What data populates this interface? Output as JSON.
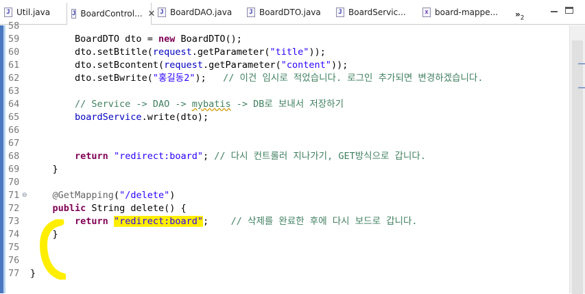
{
  "tabs": [
    {
      "label": "Util.java",
      "icon": "java-file-icon",
      "active": false
    },
    {
      "label": "BoardControl...",
      "icon": "java-file-icon",
      "active": true
    },
    {
      "label": "BoardDAO.java",
      "icon": "java-file-icon",
      "active": false
    },
    {
      "label": "BoardDTO.java",
      "icon": "java-file-icon",
      "active": false
    },
    {
      "label": "BoardServic...",
      "icon": "java-file-icon",
      "active": false
    },
    {
      "label": "board-mappe...",
      "icon": "xml-file-icon",
      "active": false
    }
  ],
  "tab_overflow": {
    "label": "»",
    "count": "2"
  },
  "editor": {
    "lines": [
      {
        "num": "58",
        "tokens": []
      },
      {
        "num": "59",
        "tokens": [
          {
            "t": "BoardDTO dto = ",
            "c": ""
          },
          {
            "t": "new",
            "c": "kw"
          },
          {
            "t": " BoardDTO();",
            "c": ""
          }
        ],
        "indent": "        "
      },
      {
        "num": "60",
        "tokens": [
          {
            "t": "dto.setBtitle(",
            "c": ""
          },
          {
            "t": "request",
            "c": "fld"
          },
          {
            "t": ".getParameter(",
            "c": ""
          },
          {
            "t": "\"title\"",
            "c": "str"
          },
          {
            "t": "));",
            "c": ""
          }
        ],
        "indent": "        "
      },
      {
        "num": "61",
        "tokens": [
          {
            "t": "dto.setBcontent(",
            "c": ""
          },
          {
            "t": "request",
            "c": "fld"
          },
          {
            "t": ".getParameter(",
            "c": ""
          },
          {
            "t": "\"content\"",
            "c": "str"
          },
          {
            "t": "));",
            "c": ""
          }
        ],
        "indent": "        "
      },
      {
        "num": "62",
        "tokens": [
          {
            "t": "dto.setBwrite(",
            "c": ""
          },
          {
            "t": "\"홍길동2\"",
            "c": "str"
          },
          {
            "t": ");   ",
            "c": ""
          },
          {
            "t": "// 이건 임시로 적었습니다. 로그인 추가되면 변경하겠습니다.",
            "c": "cm"
          }
        ],
        "indent": "        "
      },
      {
        "num": "63",
        "tokens": []
      },
      {
        "num": "64",
        "tokens": [
          {
            "t": "// Service -> DAO -> ",
            "c": "cm"
          },
          {
            "t": "mybatis",
            "c": "cm squig"
          },
          {
            "t": " -> DB로 보내서 저장하기",
            "c": "cm"
          }
        ],
        "indent": "        "
      },
      {
        "num": "65",
        "tokens": [
          {
            "t": "boardService",
            "c": "fld"
          },
          {
            "t": ".write(dto);",
            "c": ""
          }
        ],
        "indent": "        "
      },
      {
        "num": "66",
        "tokens": []
      },
      {
        "num": "67",
        "tokens": []
      },
      {
        "num": "68",
        "tokens": [
          {
            "t": "return",
            "c": "kw"
          },
          {
            "t": " ",
            "c": ""
          },
          {
            "t": "\"redirect:board\"",
            "c": "str"
          },
          {
            "t": "; ",
            "c": ""
          },
          {
            "t": "// 다시 컨트롤러 지나가기, GET방식으로 갑니다.",
            "c": "cm"
          }
        ],
        "indent": "        "
      },
      {
        "num": "69",
        "tokens": [
          {
            "t": "}",
            "c": ""
          }
        ],
        "indent": "    "
      },
      {
        "num": "70",
        "tokens": []
      },
      {
        "num": "71",
        "tokens": [
          {
            "t": "@GetMapping",
            "c": "ann"
          },
          {
            "t": "(",
            "c": ""
          },
          {
            "t": "\"/delete\"",
            "c": "str"
          },
          {
            "t": ")",
            "c": ""
          }
        ],
        "indent": "    ",
        "fold": "⊖"
      },
      {
        "num": "72",
        "tokens": [
          {
            "t": "public",
            "c": "kw"
          },
          {
            "t": " String delete() {",
            "c": ""
          }
        ],
        "indent": "    "
      },
      {
        "num": "73",
        "tokens": [
          {
            "t": "return",
            "c": "kw"
          },
          {
            "t": " ",
            "c": ""
          },
          {
            "t": "\"redirect:board\"",
            "c": "str hl"
          },
          {
            "t": ";    ",
            "c": ""
          },
          {
            "t": "// 삭제를 완료한 후에 다시 보드로 갑니다.",
            "c": "cm"
          }
        ],
        "indent": "        "
      },
      {
        "num": "74",
        "tokens": [
          {
            "t": "}",
            "c": ""
          }
        ],
        "indent": "    "
      },
      {
        "num": "75",
        "tokens": []
      },
      {
        "num": "76",
        "tokens": []
      },
      {
        "num": "77",
        "tokens": [
          {
            "t": "}",
            "c": ""
          }
        ],
        "indent": ""
      }
    ]
  },
  "colors": {
    "highlight": "#ffee00",
    "keyword": "#7f0055",
    "string": "#2a00ff",
    "comment": "#3f7f5f",
    "field": "#0000c0"
  }
}
